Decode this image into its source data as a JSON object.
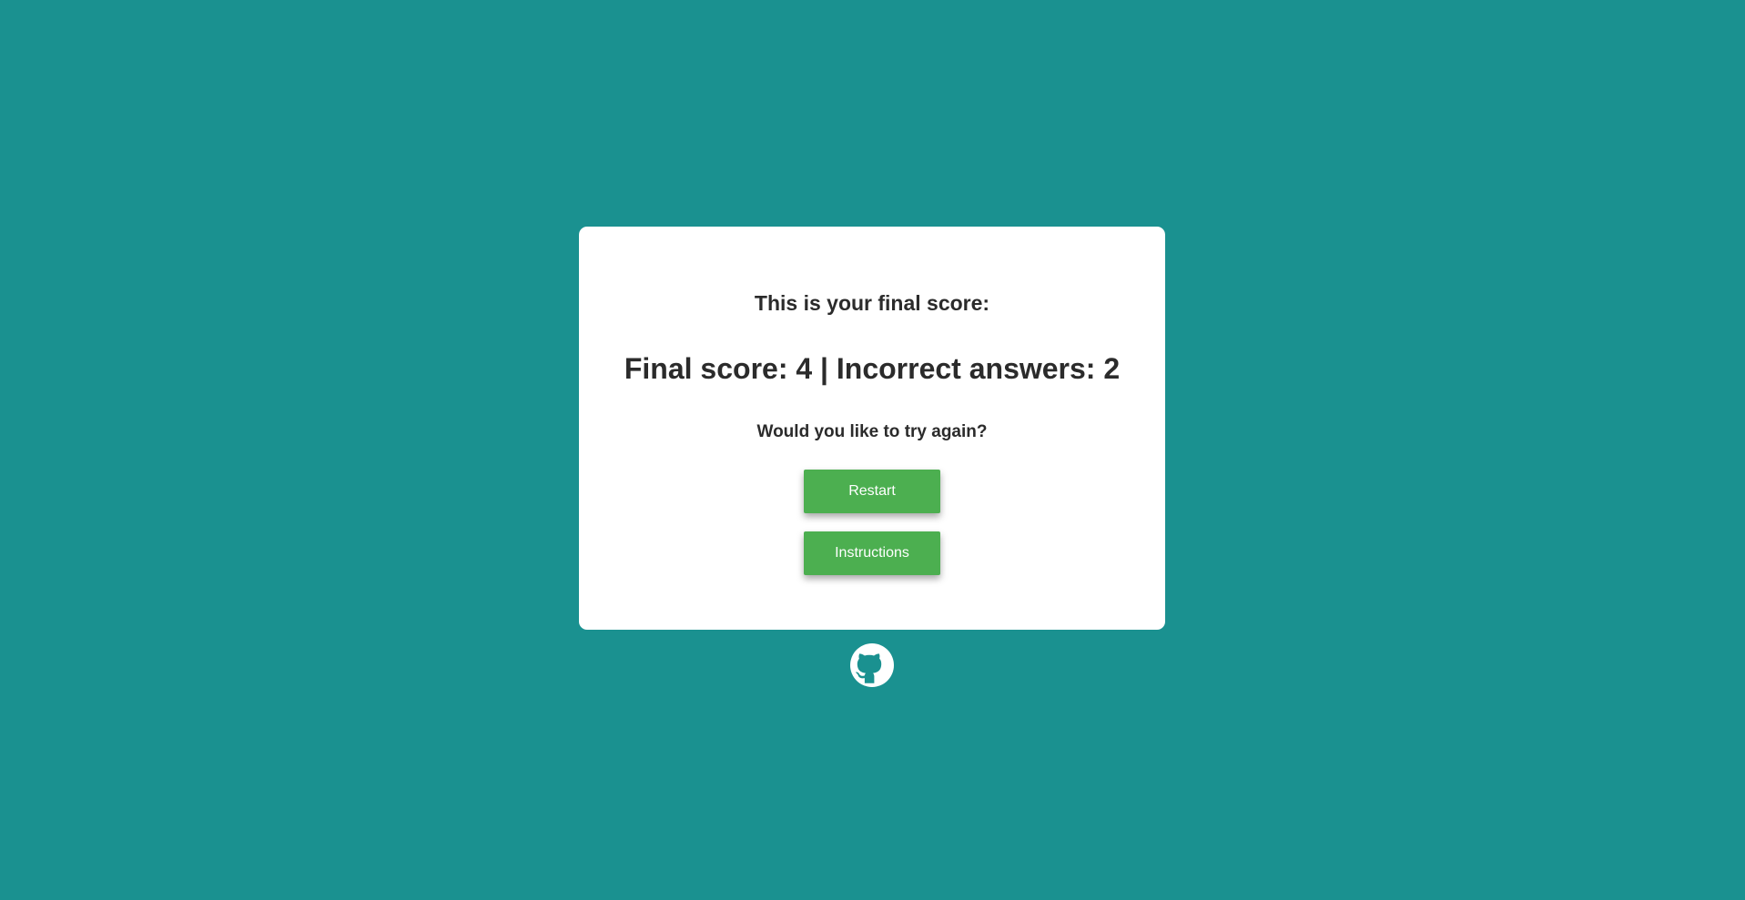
{
  "colors": {
    "background": "#1a9190",
    "card": "#ffffff",
    "button": "#4caf50",
    "text": "#2b2b2b"
  },
  "result": {
    "heading": "This is your final score:",
    "score_line": "Final score: 4 | Incorrect answers: 2",
    "prompt": "Would you like to try again?"
  },
  "buttons": {
    "restart_label": "Restart",
    "instructions_label": "Instructions"
  },
  "footer": {
    "icon": "github-icon"
  }
}
